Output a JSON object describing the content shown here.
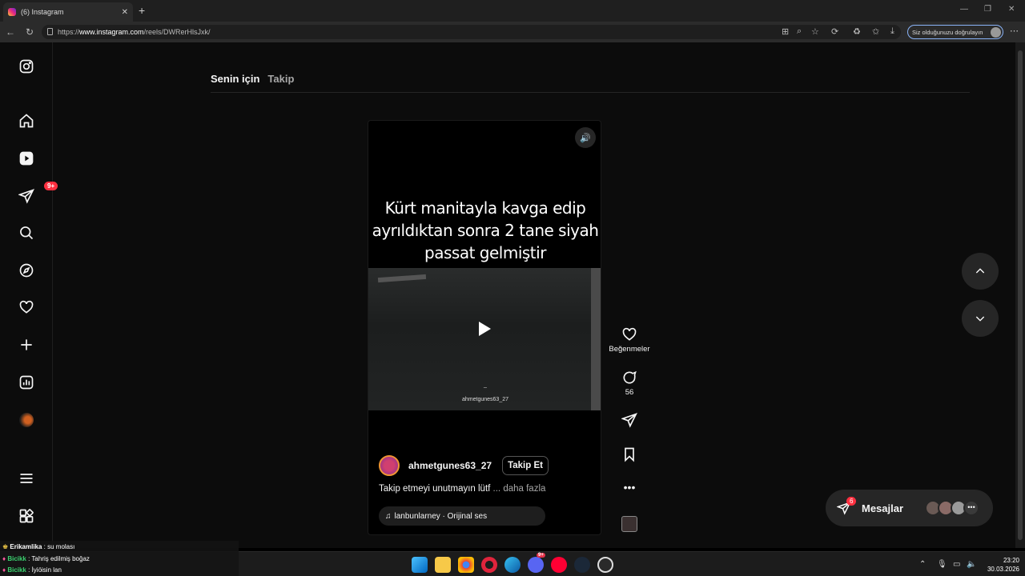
{
  "browser": {
    "tab_title": "(6) Instagram",
    "url_prefix": "https://",
    "url_host": "www.instagram.com",
    "url_path": "/reels/DWRerHlsJxk/",
    "verify_label": "Siz olduğunuzu doğrulayın"
  },
  "sidebar": {
    "notification_badge": "9+"
  },
  "feed_tabs": {
    "for_you": "Senin için",
    "following": "Takip"
  },
  "reel": {
    "caption_line1": "Kürt manitayla kavga edip",
    "caption_line2": "ayrıldıktan sonra 2 tane siyah",
    "caption_line3": "passat gelmiştir",
    "video_mark": "_",
    "watermark": "ahmetgunes63_27",
    "author": "ahmetgunes63_27",
    "follow_label": "Takip Et",
    "description": "Takip etmeyi unutmayın lütf",
    "more_label": "... daha fazla",
    "audio": "lanbunlarney · Orijinal ses"
  },
  "actions": {
    "likes_label": "Beğenmeler",
    "comments_count": "56"
  },
  "messages": {
    "label": "Mesajlar",
    "badge": "6"
  },
  "chat_overlay": [
    {
      "user": "Erikamlika",
      "text": "su molası"
    },
    {
      "user": "Bicikk",
      "text": "Tahriş edilmiş boğaz"
    },
    {
      "user": "Bicikk",
      "text": "İyiöisin lan"
    }
  ],
  "taskbar": {
    "time": "23:20",
    "date": "30.03.2026",
    "app_badge": "9+"
  },
  "colors": {
    "accent_badge": "#ff3040",
    "background": "#0c0c0c"
  }
}
